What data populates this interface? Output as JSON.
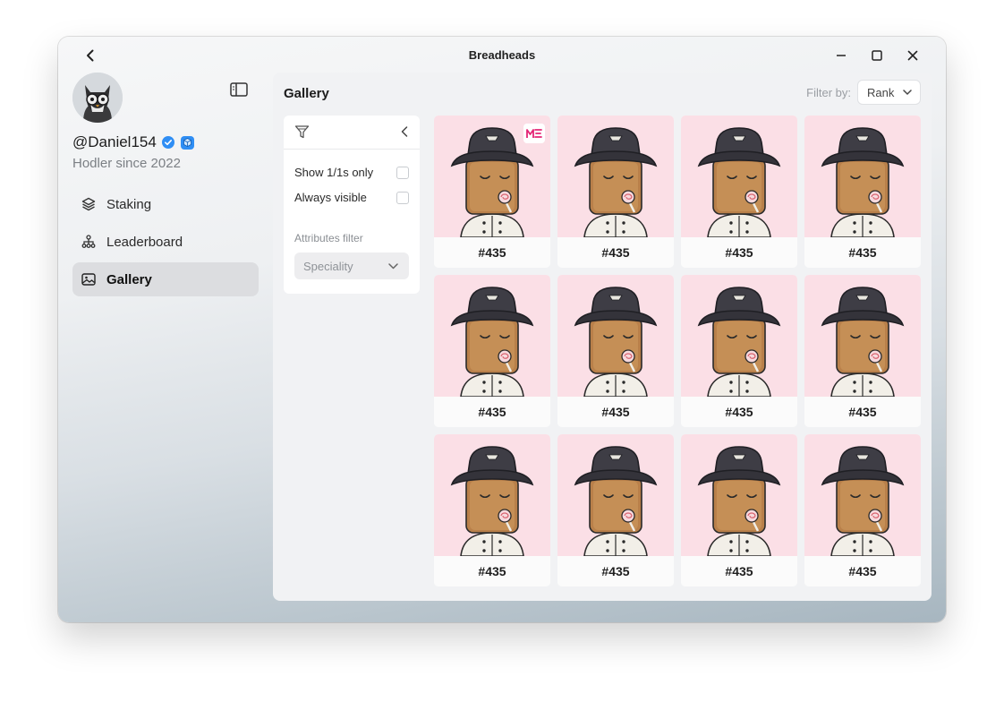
{
  "window": {
    "title": "Breadheads"
  },
  "profile": {
    "username": "@Daniel154",
    "subtitle": "Hodler since 2022"
  },
  "nav": {
    "items": [
      {
        "label": "Staking",
        "icon": "layers-icon"
      },
      {
        "label": "Leaderboard",
        "icon": "hierarchy-icon"
      },
      {
        "label": "Gallery",
        "icon": "image-icon",
        "active": true
      }
    ]
  },
  "gallery": {
    "title": "Gallery",
    "filter_by_label": "Filter by:",
    "sort_value": "Rank",
    "filters": {
      "show_1_1s_label": "Show 1/1s only",
      "always_visible_label": "Always visible",
      "attributes_label": "Attributes filter",
      "attributes_value": "Speciality"
    },
    "items": [
      {
        "label": "#435",
        "marketplace_badge": "ME"
      },
      {
        "label": "#435"
      },
      {
        "label": "#435"
      },
      {
        "label": "#435"
      },
      {
        "label": "#435"
      },
      {
        "label": "#435"
      },
      {
        "label": "#435"
      },
      {
        "label": "#435"
      },
      {
        "label": "#435"
      },
      {
        "label": "#435"
      },
      {
        "label": "#435"
      },
      {
        "label": "#435"
      }
    ]
  },
  "colors": {
    "card_background": "#fbdfe6",
    "verified_badge": "#2f8ef4",
    "active_nav": "#dcdde0",
    "marketplace_badge": "#e42575"
  }
}
